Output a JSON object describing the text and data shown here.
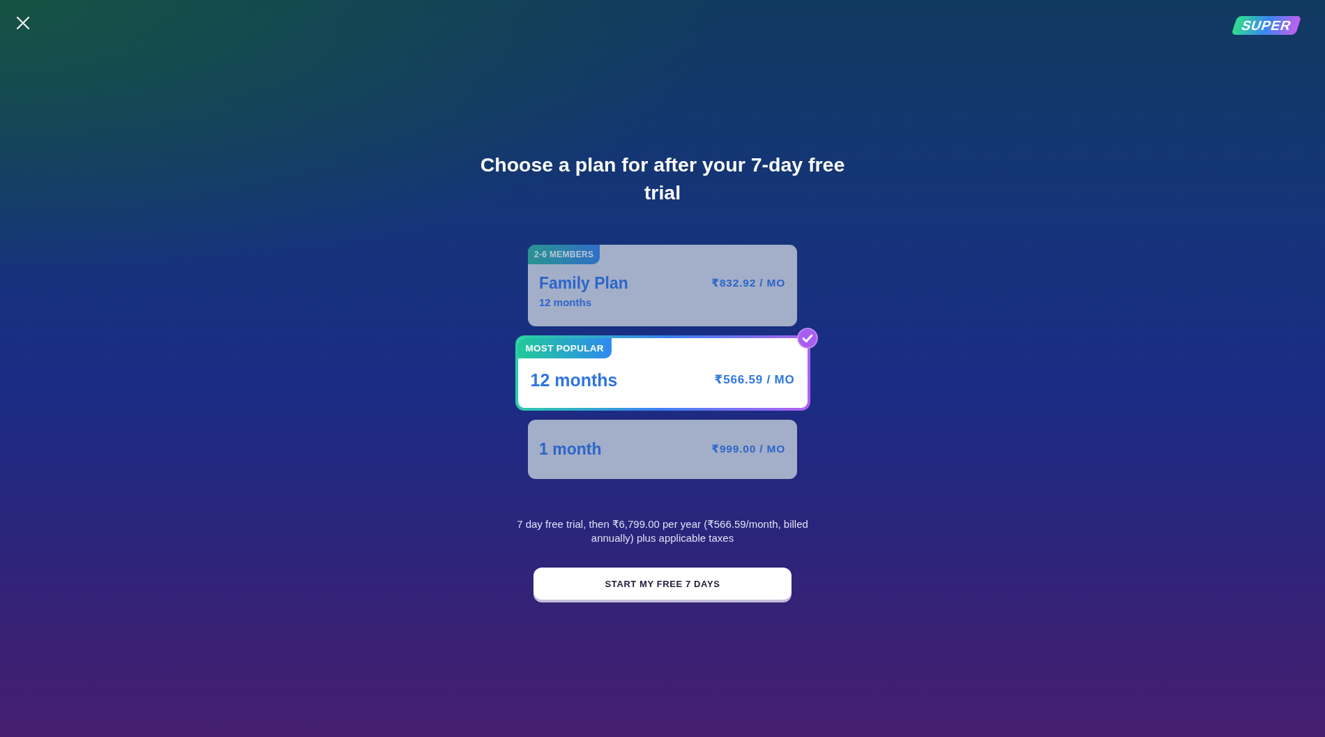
{
  "logo": {
    "text": "SUPER"
  },
  "title": "Choose a plan for after your 7-day free trial",
  "plans": [
    {
      "badge": "2-6 MEMBERS",
      "name": "Family Plan",
      "subtitle": "12 months",
      "price": "₹832.92 / MO",
      "selected": false
    },
    {
      "badge": "MOST POPULAR",
      "name": "12 months",
      "price": "₹566.59 / MO",
      "selected": true
    },
    {
      "name": "1 month",
      "price": "₹999.00 / MO",
      "selected": false
    }
  ],
  "disclaimer": "7 day free trial, then ₹6,799.00 per year (₹566.59/month, billed annually) plus applicable taxes",
  "cta_button": {
    "label": "START MY FREE 7 DAYS"
  }
}
